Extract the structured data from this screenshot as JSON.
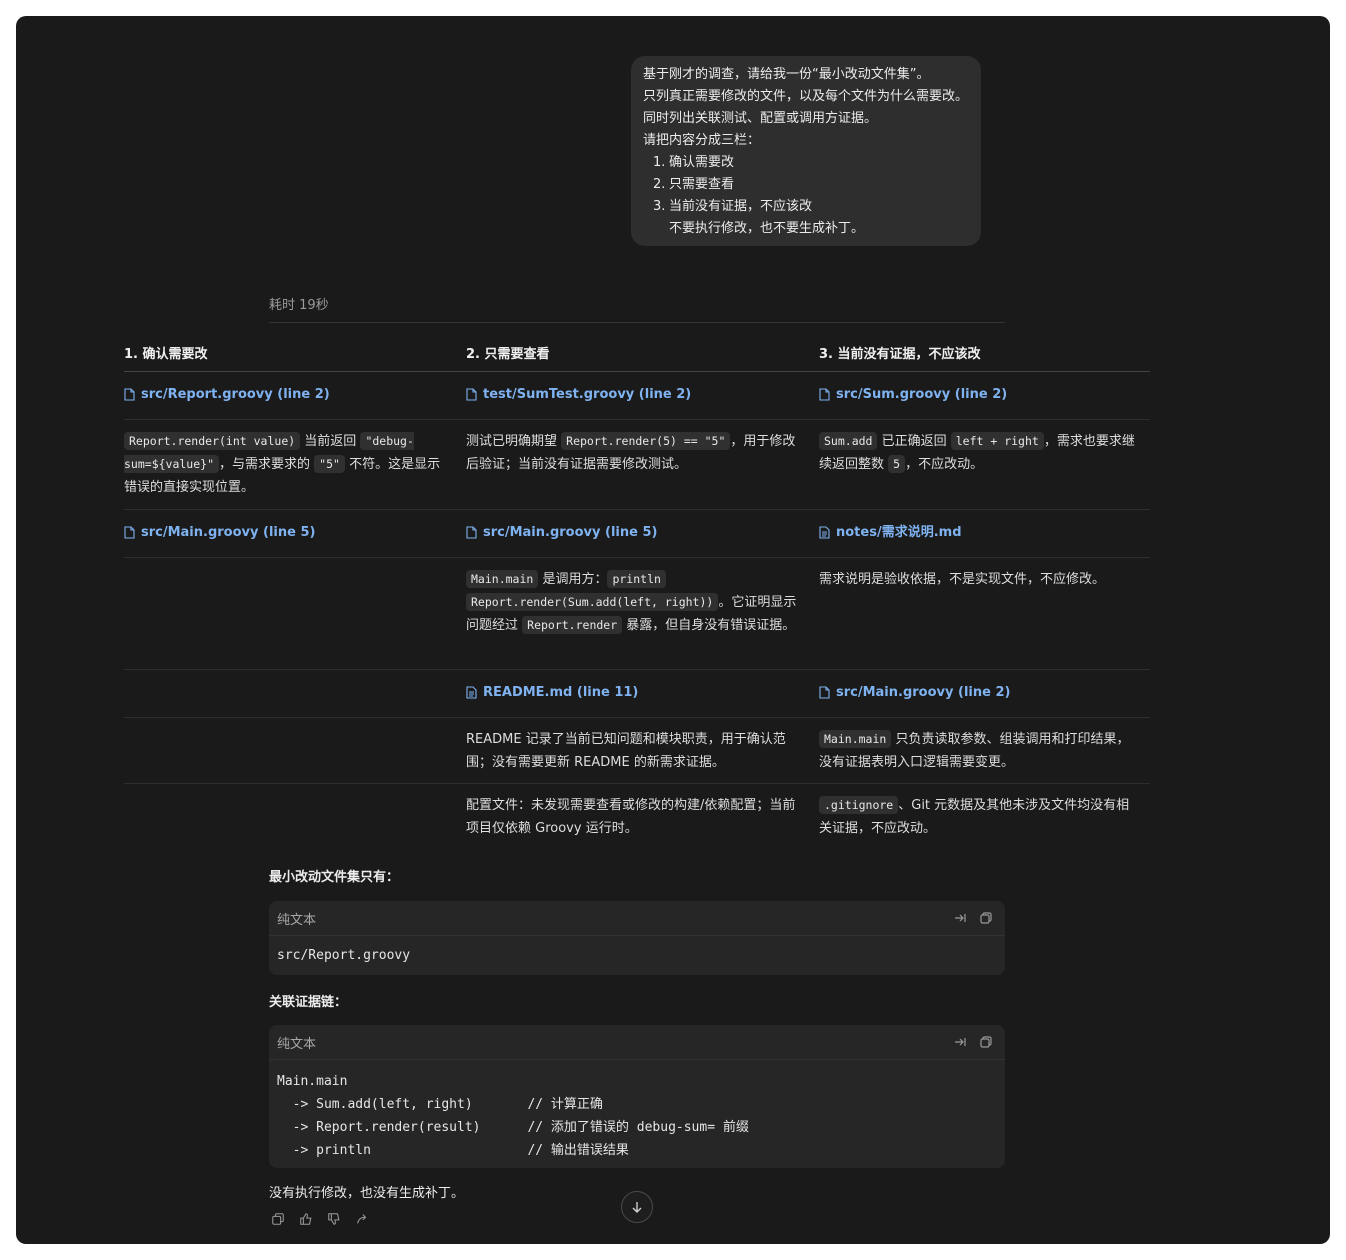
{
  "user_message": {
    "lines": [
      "基于刚才的调查，请给我一份“最小改动文件集”。",
      "只列真正需要修改的文件，以及每个文件为什么需要改。",
      "同时列出关联测试、配置或调用方证据。",
      "请把内容分成三栏："
    ],
    "items": [
      {
        "num": "1.",
        "text": "确认需要改"
      },
      {
        "num": "2.",
        "text": "只需要查看"
      },
      {
        "num": "3.",
        "text": "当前没有证据，不应该改"
      }
    ],
    "continuation": "不要执行修改，也不要生成补丁。"
  },
  "elapsed": "耗时 19秒",
  "table": {
    "headers": [
      "1. 确认需要改",
      "2. 只需要查看",
      "3. 当前没有证据，不应该改"
    ],
    "r1": {
      "c1": "src/Report.groovy (line 2)",
      "c2": "test/SumTest.groovy (line 2)",
      "c3": "src/Sum.groovy (line 2)"
    },
    "r2": {
      "c1": {
        "code1": "Report.render(int value)",
        "t1": " 当前返回 ",
        "code2": "\"debug-sum=${value}\"",
        "t2": "，与需求要求的 ",
        "code3": "\"5\"",
        "t3": " 不符。这是显示错误的直接实现位置。"
      },
      "c2": {
        "t1": "测试已明确期望 ",
        "code1": "Report.render(5) == \"5\"",
        "t2": "，用于修改后验证；当前没有证据需要修改测试。"
      },
      "c3": {
        "code1": "Sum.add",
        "t1": " 已正确返回 ",
        "code2": "left + right",
        "t2": "，需求也要求继续返回整数 ",
        "code3": "5",
        "t3": "，不应改动。"
      }
    },
    "r3": {
      "c2": "src/Main.groovy (line 5)",
      "c1": "src/Main.groovy (line 5)",
      "c3": "notes/需求说明.md"
    },
    "r4": {
      "c2": {
        "code1": "Main.main",
        "t1": " 是调用方：",
        "code2": "println",
        "code3": "Report.render(Sum.add(left, right))",
        "t2": "。它证明显示问题经过 ",
        "code4": "Report.render",
        "t3": " 暴露，但自身没有错误证据。"
      },
      "c3": "需求说明是验收依据，不是实现文件，不应修改。"
    },
    "r5": {
      "c2": "README.md (line 11)",
      "c3": "src/Main.groovy (line 2)"
    },
    "r6": {
      "c2": "README 记录了当前已知问题和模块职责，用于确认范围；没有需要更新 README 的新需求证据。",
      "c3": {
        "code1": "Main.main",
        "t1": " 只负责读取参数、组装调用和打印结果，没有证据表明入口逻辑需要变更。"
      }
    },
    "r7": {
      "c2": "配置文件：未发现需要查看或修改的构建/依赖配置；当前项目仅依赖 Groovy 运行时。",
      "c3": {
        "code1": ".gitignore",
        "t1": "、Git 元数据及其他未涉及文件均没有相关证据，不应改动。"
      }
    }
  },
  "minimal_set_label": "最小改动文件集只有：",
  "codeblock1": {
    "lang": "纯文本",
    "content": "src/Report.groovy"
  },
  "evidence_label": "关联证据链：",
  "codeblock2": {
    "lang": "纯文本",
    "content": "Main.main\n  -> Sum.add(left, right)       // 计算正确\n  -> Report.render(result)      // 添加了错误的 debug-sum= 前缀\n  -> println                    // 输出错误结果"
  },
  "final_note": "没有执行修改，也没有生成补丁。",
  "icons": {
    "file": "file-icon",
    "note": "note-icon",
    "wrap": "wrap-icon",
    "copy": "copy-icon",
    "thumbs_up": "thumbs-up-icon",
    "thumbs_down": "thumbs-down-icon",
    "share": "share-icon",
    "arrow_down": "arrow-down-icon"
  },
  "colors": {
    "background": "#1a1a1a",
    "link": "#7fb2f0",
    "bubble": "#2e2e2e",
    "code_bg": "#262626"
  }
}
